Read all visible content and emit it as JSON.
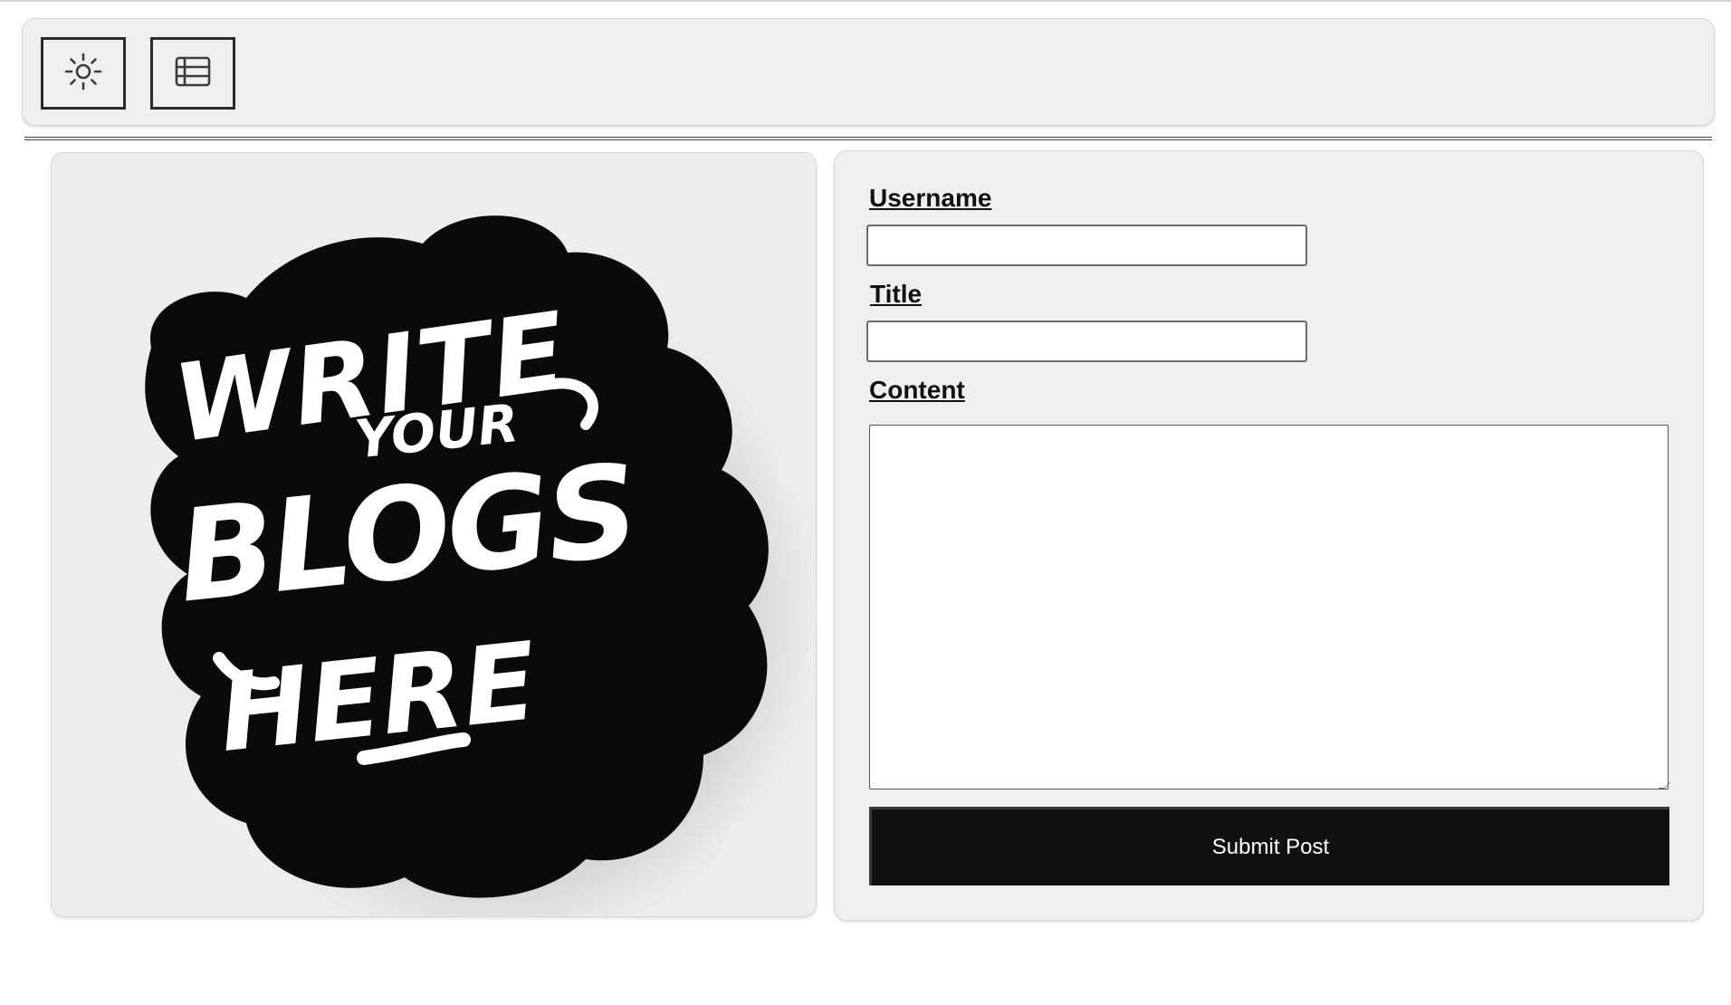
{
  "toolbar": {
    "buttons": [
      {
        "icon": "sun-icon",
        "purpose": "toggle-theme"
      },
      {
        "icon": "list-icon",
        "purpose": "view-posts"
      }
    ]
  },
  "hero": {
    "artwork_text": [
      "WRITE",
      "YOUR",
      "BLOGS",
      "HERE"
    ]
  },
  "form": {
    "username_label": "Username",
    "username_value": "",
    "title_label": "Title",
    "title_value": "",
    "content_label": "Content",
    "content_value": "",
    "submit_label": "Submit Post"
  },
  "colors": {
    "panel_bg": "#eeeff1",
    "button_bg": "#111111",
    "button_text": "#ffffff",
    "sticker_black": "#0a0a0a"
  }
}
